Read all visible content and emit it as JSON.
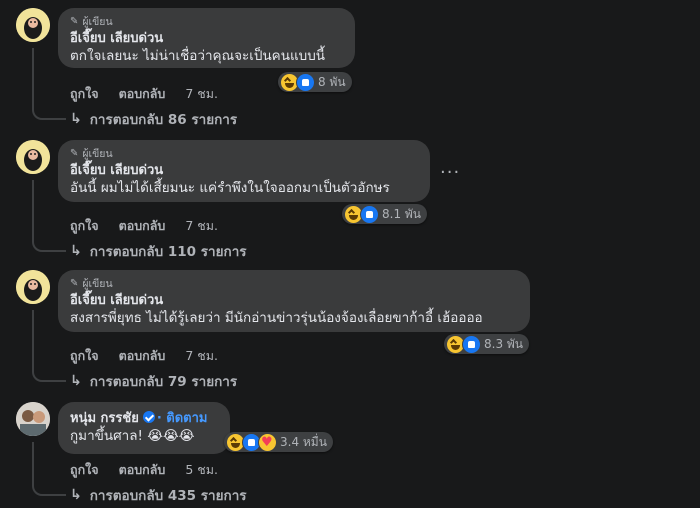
{
  "comments": [
    {
      "badge": "ผู้เขียน",
      "name": "อีเจี๊ยบ เลียบด่วน",
      "text": "ตกใจเลยนะ ไม่น่าเชื่อว่าคุณจะเป็นคนแบบนี้",
      "reactions": [
        "haha-icon",
        "like-icon"
      ],
      "reaction_count": "8 พัน",
      "like_label": "ถูกใจ",
      "reply_label": "ตอบกลับ",
      "time": "7 ชม.",
      "replies_label": "การตอบกลับ 86 รายการ"
    },
    {
      "badge": "ผู้เขียน",
      "name": "อีเจี๊ยบ เลียบด่วน",
      "text": "อันนี้ ผมไม่ได้เสี้ยมนะ แค่รำพึงในใจออกมาเป็นตัวอักษร",
      "reactions": [
        "haha-icon",
        "like-icon"
      ],
      "reaction_count": "8.1 พัน",
      "like_label": "ถูกใจ",
      "reply_label": "ตอบกลับ",
      "time": "7 ชม.",
      "replies_label": "การตอบกลับ 110 รายการ",
      "more": "···"
    },
    {
      "badge": "ผู้เขียน",
      "name": "อีเจี๊ยบ เลียบด่วน",
      "text": "สงสารพี่ยุทธ ไม่ได้รู้เลยว่า มีนักอ่านข่าวรุ่นน้องจ้องเลื่อยขาก้าอี้ เฮ้ออออ",
      "reactions": [
        "haha-icon",
        "like-icon"
      ],
      "reaction_count": "8.3 พัน",
      "like_label": "ถูกใจ",
      "reply_label": "ตอบกลับ",
      "time": "7 ชม.",
      "replies_label": "การตอบกลับ 79 รายการ"
    },
    {
      "name": "หนุ่ม กรรชัย",
      "follow": "· ติดตาม",
      "text": "กูมาขึ้นศาล! 😭😭😭",
      "reactions": [
        "haha-icon",
        "like-icon",
        "care-icon"
      ],
      "reaction_count": "3.4 หมื่น",
      "like_label": "ถูกใจ",
      "reply_label": "ตอบกลับ",
      "time": "5 ชม.",
      "replies_label": "การตอบกลับ 435 รายการ"
    }
  ],
  "colors": {
    "bg": "#18191a",
    "bubble": "#3a3b3c",
    "text": "#e4e6eb",
    "muted": "#b0b3b8",
    "link": "#4599ff"
  }
}
